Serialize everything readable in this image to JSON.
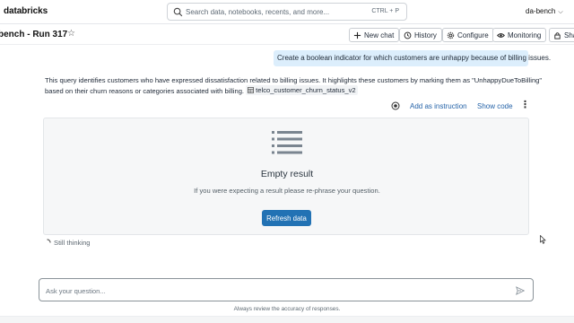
{
  "app": {
    "logo": "databricks",
    "workspace": "da-bench"
  },
  "search": {
    "placeholder": "Search data, notebooks, recents, and more...",
    "shortcut": "CTRL + P"
  },
  "header": {
    "title": "bench - Run 317",
    "buttons": {
      "new_chat": "New chat",
      "history": "History",
      "configure": "Configure",
      "monitoring": "Monitoring",
      "share": "Sha"
    }
  },
  "conversation": {
    "user_message": "Create a boolean indicator for which customers are unhappy because of billing issues.",
    "response_line1": "This query identifies customers who have expressed dissatisfaction related to billing issues. It highlights these customers by marking them as \"UnhappyDueToBilling\"",
    "response_line2": "based on their churn reasons or categories associated with billing.",
    "table_ref": "telco_customer_churn_status_v2",
    "actions": {
      "add_instruction": "Add as instruction",
      "show_code": "Show code",
      "more": "⋮"
    },
    "result": {
      "title": "Empty result",
      "subtitle": "If you were expecting a result please re-phrase your question.",
      "refresh": "Refresh data"
    },
    "status": "Still thinking"
  },
  "composer": {
    "placeholder": "Ask your question...",
    "disclaimer": "Always review the accuracy of responses."
  },
  "colors": {
    "accent": "#2272b4",
    "bubble": "#dceefc",
    "link": "#2563a8"
  }
}
